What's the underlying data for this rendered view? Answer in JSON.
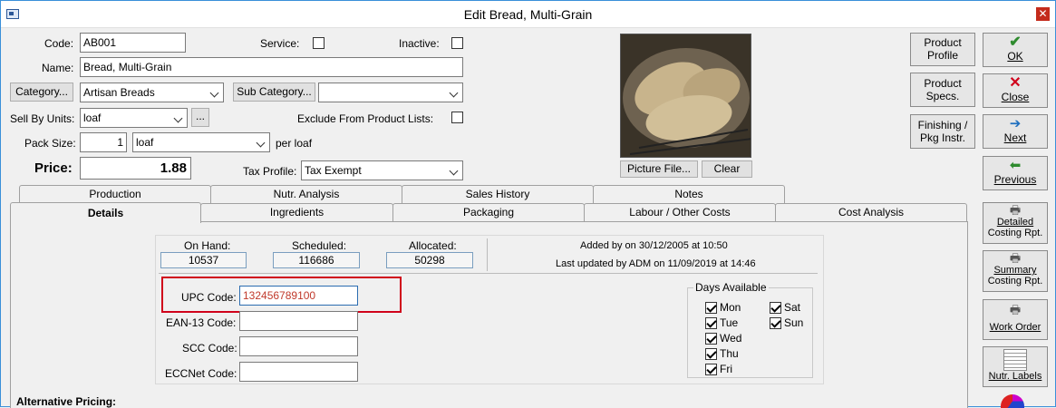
{
  "window": {
    "title": "Edit Bread, Multi-Grain"
  },
  "form": {
    "code_label": "Code:",
    "code_value": "AB001",
    "service_label": "Service:",
    "service_checked": false,
    "inactive_label": "Inactive:",
    "inactive_checked": false,
    "name_label": "Name:",
    "name_value": "Bread, Multi-Grain",
    "category_button": "Category...",
    "category_value": "Artisan Breads",
    "subcategory_button": "Sub Category...",
    "subcategory_value": "",
    "sellby_label": "Sell By Units:",
    "sellby_value": "loaf",
    "sellby_more": "...",
    "exclude_label": "Exclude From Product Lists:",
    "exclude_checked": false,
    "packsize_label": "Pack Size:",
    "packsize_value": "1",
    "packsize_unit": "loaf",
    "per_label": "per loaf",
    "price_label": "Price:",
    "price_value": "1.88",
    "tax_label": "Tax Profile:",
    "tax_value": "Tax Exempt"
  },
  "picture": {
    "file_button": "Picture File...",
    "clear_button": "Clear"
  },
  "right_buttons": {
    "product_profile": [
      "Product",
      "Profile"
    ],
    "product_specs": [
      "Product",
      "Specs."
    ],
    "finishing": [
      "Finishing /",
      "Pkg Instr."
    ],
    "ok": "OK",
    "close": "Close",
    "next": "Next",
    "previous": "Previous",
    "detailed_costing": [
      "Detailed",
      "Costing Rpt."
    ],
    "summary_costing": [
      "Summary",
      "Costing Rpt."
    ],
    "work_order": "Work Order",
    "nutr_labels": "Nutr. Labels"
  },
  "tabs": {
    "row1": [
      "Production",
      "Nutr. Analysis",
      "Sales History",
      "Notes"
    ],
    "row2": [
      "Details",
      "Ingredients",
      "Packaging",
      "Labour / Other Costs",
      "Cost Analysis"
    ]
  },
  "details": {
    "onhand_label": "On Hand:",
    "onhand_value": "10537",
    "scheduled_label": "Scheduled:",
    "scheduled_value": "116686",
    "allocated_label": "Allocated:",
    "allocated_value": "50298",
    "added_by": "Added by  on 30/12/2005 at 10:50",
    "last_updated": "Last updated by ADM on 11/09/2019 at 14:46",
    "upc_label": "UPC Code:",
    "upc_value": "132456789100",
    "ean_label": "EAN-13 Code:",
    "ean_value": "",
    "scc_label": "SCC Code:",
    "scc_value": "",
    "eccnet_label": "ECCNet Code:",
    "eccnet_value": "",
    "days_title": "Days Available",
    "days": [
      {
        "label": "Mon",
        "checked": true
      },
      {
        "label": "Tue",
        "checked": true
      },
      {
        "label": "Wed",
        "checked": true
      },
      {
        "label": "Thu",
        "checked": true
      },
      {
        "label": "Fri",
        "checked": true
      },
      {
        "label": "Sat",
        "checked": true
      },
      {
        "label": "Sun",
        "checked": true
      }
    ],
    "alt_pricing_label": "Alternative Pricing:"
  },
  "colors": {
    "highlight": "#d0021b",
    "upc_text": "#c0392b"
  }
}
